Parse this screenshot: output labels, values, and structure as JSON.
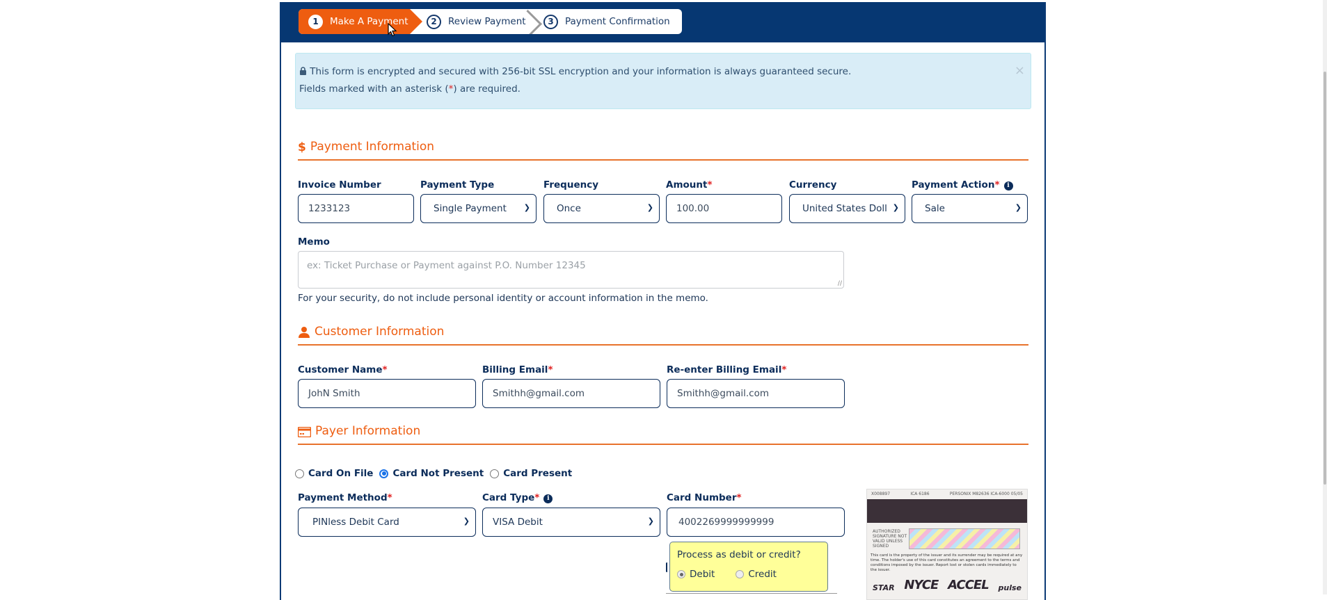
{
  "steps": [
    {
      "num": "1",
      "label": "Make A Payment",
      "active": true
    },
    {
      "num": "2",
      "label": "Review Payment",
      "active": false
    },
    {
      "num": "3",
      "label": "Payment Confirmation",
      "active": false
    }
  ],
  "alert": {
    "line1": "This form is encrypted and secured with 256-bit SSL encryption and your information is always guaranteed secure.",
    "line2_pre": "Fields marked with an asterisk (",
    "line2_star": "*",
    "line2_post": ") are required.",
    "close": "×"
  },
  "payment_info": {
    "title": "Payment Information",
    "icon": "$",
    "fields": {
      "invoice_label": "Invoice Number",
      "invoice_value": "1233123",
      "payment_type_label": "Payment Type",
      "payment_type_value": "Single Payment",
      "frequency_label": "Frequency",
      "frequency_value": "Once",
      "amount_label": "Amount",
      "amount_value": "100.00",
      "currency_label": "Currency",
      "currency_value": "United States Doll",
      "payment_action_label": "Payment Action",
      "payment_action_value": "Sale"
    },
    "memo_label": "Memo",
    "memo_placeholder": "ex: Ticket Purchase or Payment against P.O. Number 12345",
    "memo_help": "For your security, do not include personal identity or account information in the memo."
  },
  "customer_info": {
    "title": "Customer Information",
    "name_label": "Customer Name",
    "name_value": "JohN Smith",
    "email_label": "Billing Email",
    "email_value": "Smithh@gmail.com",
    "reemail_label": "Re-enter Billing Email",
    "reemail_value": "Smithh@gmail.com"
  },
  "payer_info": {
    "title": "Payer Information",
    "card_modes": [
      {
        "label": "Card On File",
        "selected": false
      },
      {
        "label": "Card Not Present",
        "selected": true
      },
      {
        "label": "Card Present",
        "selected": false
      }
    ],
    "payment_method_label": "Payment Method",
    "payment_method_value": "PINless Debit Card",
    "card_type_label": "Card Type",
    "card_type_value": "VISA Debit",
    "card_number_label": "Card Number",
    "card_number_value": "4002269999999999",
    "popup": {
      "question": "Process as debit or credit?",
      "options": [
        {
          "label": "Debit",
          "selected": true
        },
        {
          "label": "Credit",
          "selected": false
        }
      ]
    },
    "card_image": {
      "top_left": "X008897",
      "top_mid": "ICA 6186",
      "top_right": "PERSONIX M82636 ICA-6000 05/05",
      "signature_label": "AUTHORIZED SIGNATURE NOT VALID UNLESS SIGNED",
      "fine_print": "This card is the property of the issuer and its surrender may be required at any time. The holder's use of this card constitutes an agreement to the terms and conditions imposed by the issuer. Report lost or stolen cards immediately to the issuer.",
      "networks": [
        "STAR",
        "NYCE",
        "ACCEL",
        "pulse"
      ]
    }
  },
  "required_mark": "*",
  "colors": {
    "header": "#063772",
    "accent": "#ee5d10",
    "alert_bg": "#d9edf7",
    "popup_bg": "#ffff99"
  }
}
